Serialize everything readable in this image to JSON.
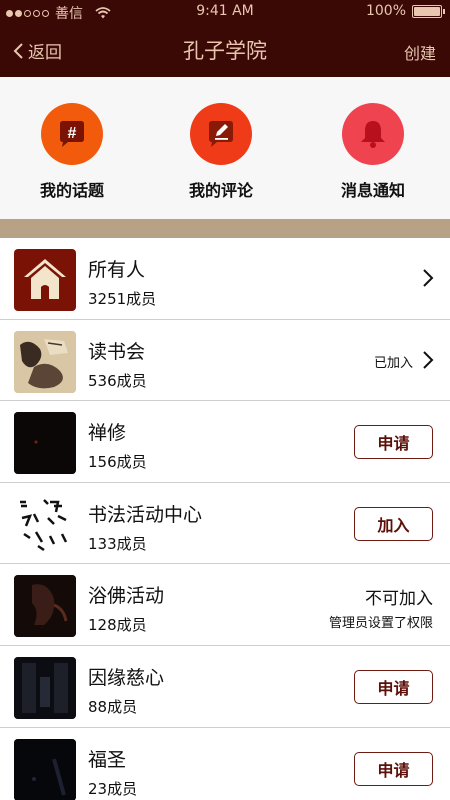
{
  "status_bar": {
    "carrier": "善信",
    "time": "9:41 AM",
    "battery": "100%",
    "signal_bars": 2,
    "battery_level": 1.0
  },
  "nav": {
    "back_label": "返回",
    "title": "孔子学院",
    "create_label": "创建"
  },
  "quick_actions": [
    {
      "label": "我的话题",
      "icon": "hash-bubble-icon",
      "color": "#f25a0c"
    },
    {
      "label": "我的评论",
      "icon": "pencil-bubble-icon",
      "color": "#ef3b17"
    },
    {
      "label": "消息通知",
      "icon": "bell-icon",
      "color": "#ef4350"
    }
  ],
  "groups": [
    {
      "name": "所有人",
      "members": "3251成员",
      "action": "chevron"
    },
    {
      "name": "读书会",
      "members": "536成员",
      "action": "joined",
      "joined_label": "已加入"
    },
    {
      "name": "禅修",
      "members": "156成员",
      "action": "button",
      "button_label": "申请"
    },
    {
      "name": "书法活动中心",
      "members": "133成员",
      "action": "button",
      "button_label": "加入"
    },
    {
      "name": "浴佛活动",
      "members": "128成员",
      "action": "unavailable",
      "status": "不可加入",
      "note": "管理员设置了权限"
    },
    {
      "name": "因缘慈心",
      "members": "88成员",
      "action": "button",
      "button_label": "申请"
    },
    {
      "name": "福圣",
      "members": "23成员",
      "action": "button",
      "button_label": "申请"
    }
  ],
  "colors": {
    "nav_bg": "#3a0805",
    "nav_text": "#e8c6b0",
    "divider_band": "#b7a285",
    "button_border": "#6e1b12"
  }
}
